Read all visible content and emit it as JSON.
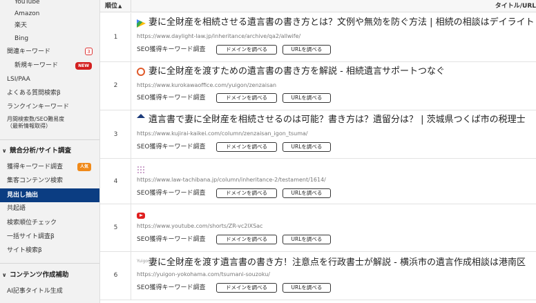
{
  "sidebar": {
    "items": [
      {
        "label": "YouTube"
      },
      {
        "label": "Amazon"
      },
      {
        "label": "楽天"
      },
      {
        "label": "Bing"
      },
      {
        "label": "関連キーワード",
        "count": "3"
      },
      {
        "label": "新規キーワード",
        "badge": "NEW"
      },
      {
        "label": "LSI/PAA"
      },
      {
        "label": "よくある質問検索β"
      },
      {
        "label": "ランクインキーワード"
      },
      {
        "label": "月間検索数/SEO難易度",
        "sub": "（最新情報取得）"
      },
      {
        "label": "獲得キーワード調査",
        "badge": "人気"
      },
      {
        "label": "集客コンテンツ検索"
      },
      {
        "label": "見出し抽出"
      },
      {
        "label": "共起語"
      },
      {
        "label": "検索順位チェック"
      },
      {
        "label": "一括サイト調査β"
      },
      {
        "label": "サイト検索β"
      },
      {
        "label": "AI記事タイトル生成"
      }
    ],
    "sections": [
      {
        "label": "競合分析/サイト調査",
        "chevron": "∨"
      },
      {
        "label": "コンテンツ作成補助",
        "chevron": "∨"
      }
    ]
  },
  "table": {
    "header": {
      "rank": "順位",
      "sort_icon": "▲",
      "title": "タイトル/URL"
    },
    "seo_label": "SEO獲得キーワード調査",
    "domain_button": "ドメインを調べる",
    "url_button": "URLを調べる",
    "rows": [
      {
        "rank": "1",
        "icon": "google-drive-icon",
        "title": "妻に全財産を相続させる遺言書の書き方とは？文例や無効を防ぐ方法 | 相続の相談はデイライト",
        "url": "https://www.daylight-law.jp/inheritance/archive/qa2/allwife/"
      },
      {
        "rank": "2",
        "icon": "ring-logo-icon",
        "title": "妻に全財産を渡すための遺言書の書き方を解説 - 相続遺言サポートつなぐ",
        "url": "https://www.kurokawaoffice.com/yuigon/zenzaisan"
      },
      {
        "rank": "3",
        "icon": "mountain-logo-icon",
        "title": "遺言書で妻に全財産を相続させるのは可能？書き方は？遺留分は？ | 茨城県つくば市の税理士",
        "url": "https://www.kujirai-kaikei.com/column/zenzaisan_igon_tsuma/"
      },
      {
        "rank": "4",
        "icon": "dots-logo-icon",
        "title": "",
        "url": "https://www.law-tachibana.jp/column/inheritance-2/testament/1614/"
      },
      {
        "rank": "5",
        "icon": "youtube-icon",
        "title": "",
        "url": "https://www.youtube.com/shorts/ZR-vc2lXSac"
      },
      {
        "rank": "6",
        "icon": "text-logo-icon",
        "icon_text": "Yuigon",
        "title": "妻に全財産を渡す遺言書の書き方！注意点を行政書士が解説 - 横浜市の遺言作成相談は港南区",
        "url": "https://yuigon-yokohama.com/tsumani-souzoku/"
      }
    ]
  }
}
